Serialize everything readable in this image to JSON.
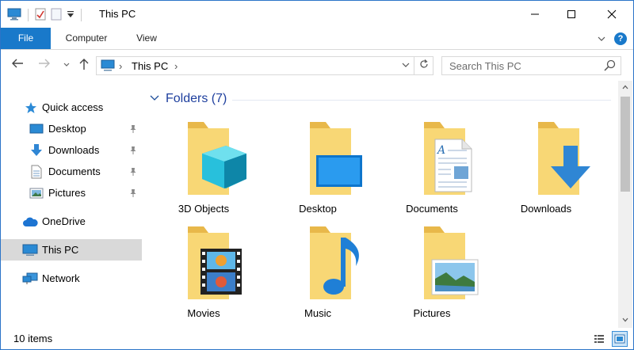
{
  "window": {
    "title": "This PC",
    "controls": {
      "minimize": "minimize",
      "maximize": "maximize",
      "close": "close"
    }
  },
  "ribbon": {
    "tabs": [
      {
        "label": "File"
      },
      {
        "label": "Computer"
      },
      {
        "label": "View"
      }
    ]
  },
  "navigation": {
    "breadcrumb": [
      "This PC"
    ],
    "search_placeholder": "Search This PC"
  },
  "sidebar": {
    "items": [
      {
        "label": "Quick access",
        "icon": "star-icon"
      },
      {
        "label": "Desktop",
        "icon": "desktop-icon",
        "pinned": true
      },
      {
        "label": "Downloads",
        "icon": "downloads-icon",
        "pinned": true
      },
      {
        "label": "Documents",
        "icon": "documents-icon",
        "pinned": true
      },
      {
        "label": "Pictures",
        "icon": "pictures-icon",
        "pinned": true
      },
      {
        "label": "OneDrive",
        "icon": "cloud-icon"
      },
      {
        "label": "This PC",
        "icon": "computer-icon",
        "selected": true
      },
      {
        "label": "Network",
        "icon": "network-icon"
      }
    ]
  },
  "content": {
    "group_title": "Folders (7)",
    "folders": [
      {
        "label": "3D Objects",
        "overlay": "cube-icon"
      },
      {
        "label": "Desktop",
        "overlay": "monitor-icon"
      },
      {
        "label": "Documents",
        "overlay": "document-page-icon"
      },
      {
        "label": "Downloads",
        "overlay": "down-arrow-icon"
      },
      {
        "label": "Movies",
        "overlay": "film-strip-icon"
      },
      {
        "label": "Music",
        "overlay": "music-note-icon"
      },
      {
        "label": "Pictures",
        "overlay": "photo-icon"
      }
    ]
  },
  "status": {
    "item_count": "10 items"
  },
  "colors": {
    "accent": "#1979ca",
    "folder": "#f8d775",
    "folder_dark": "#e8b84a",
    "selected_bg": "#d9d9d9",
    "group_title": "#1e3f9e"
  }
}
